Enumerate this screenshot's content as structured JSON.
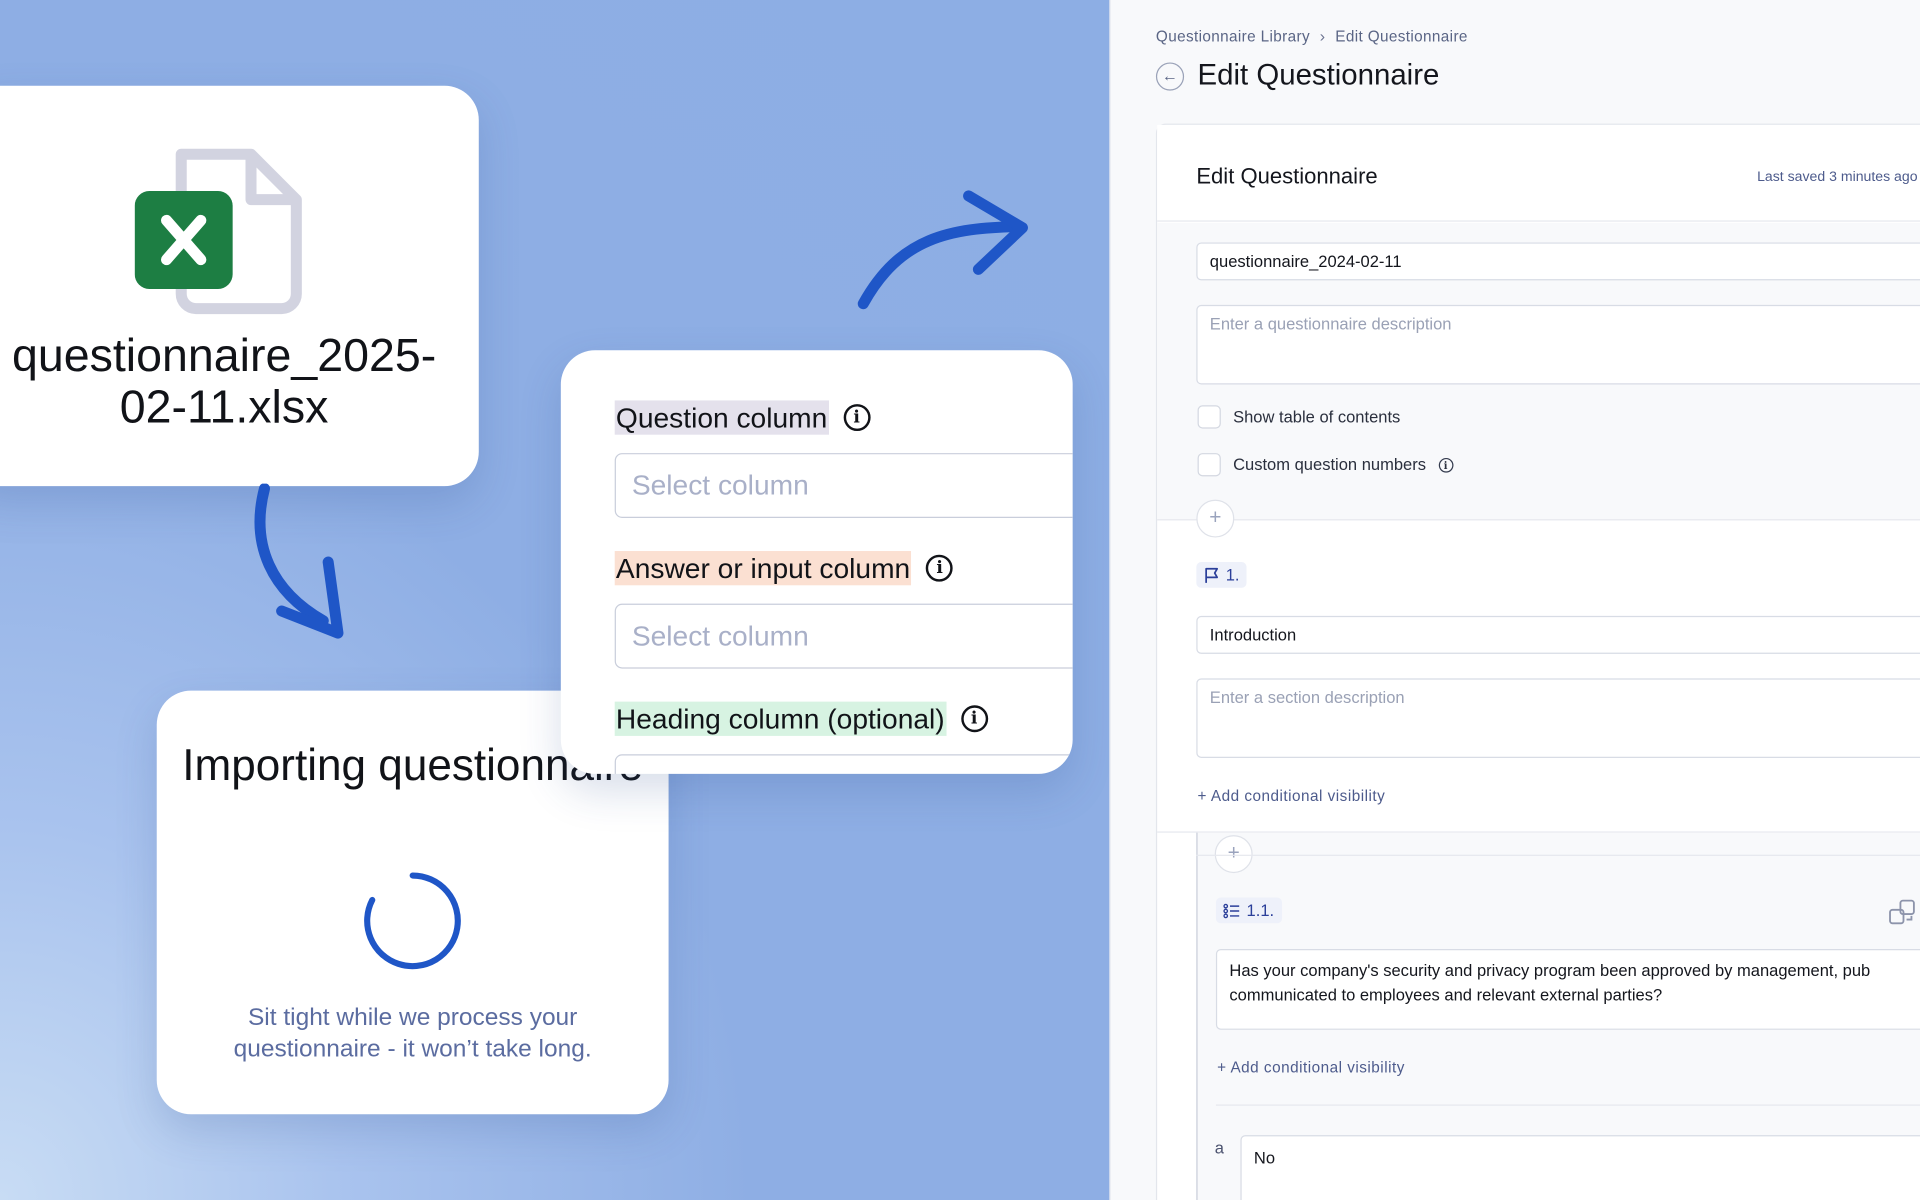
{
  "file_card": {
    "file_name": "questionnaire_2025-02-11.xlsx",
    "icon": "excel-file-icon",
    "icon_color": "#1d7e43"
  },
  "import_card": {
    "title": "Importing questionnaire",
    "subtitle": "Sit tight while we process your questionnaire - it won’t take long.",
    "spinner_color": "#1f56c7"
  },
  "column_map": {
    "question_label": "Question column",
    "question_placeholder": "Select column",
    "answer_label": "Answer or input column",
    "answer_placeholder": "Select column",
    "heading_label": "Heading column (optional)"
  },
  "panel": {
    "breadcrumb": {
      "root": "Questionnaire Library",
      "current": "Edit Questionnaire"
    },
    "page_title": "Edit Questionnaire",
    "editor": {
      "title": "Edit Questionnaire",
      "last_saved": "Last saved 3 minutes ago",
      "name_value": "questionnaire_2024-02-11",
      "description_placeholder": "Enter a questionnaire description",
      "show_toc_label": "Show table of contents",
      "custom_numbers_label": "Custom question numbers",
      "section": {
        "number": "1.",
        "title_value": "Introduction",
        "description_placeholder": "Enter a section description",
        "add_visibility": "+ Add conditional visibility"
      },
      "question": {
        "number": "1.1.",
        "text": "Has your company's security and privacy program been approved by management, pub communicated to employees and relevant external parties?",
        "add_visibility": "+ Add conditional visibility",
        "option_letter": "a",
        "option_value": "No"
      }
    }
  },
  "colors": {
    "accent": "#1f56c7",
    "background": "#8eaee3",
    "link": "#4d5b8c"
  }
}
